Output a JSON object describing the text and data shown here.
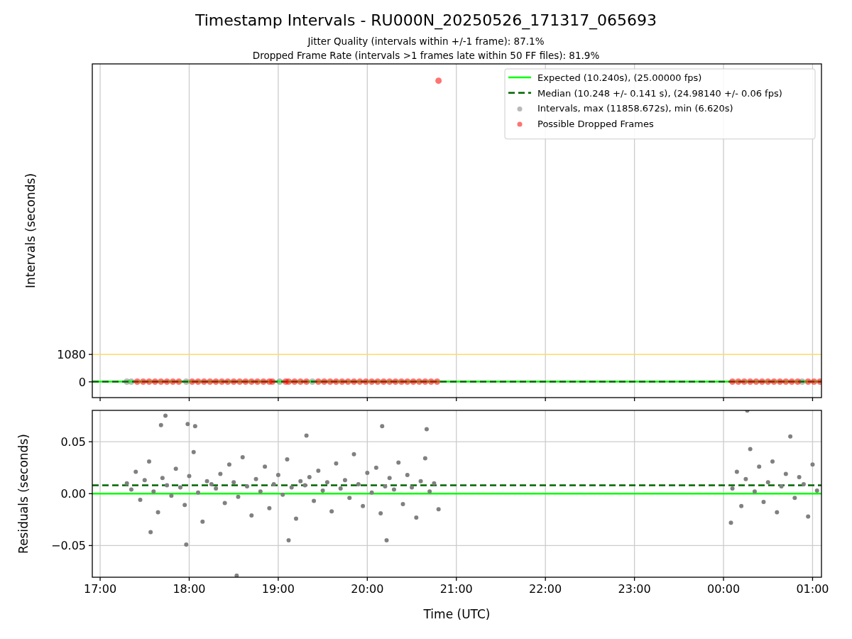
{
  "figure": {
    "title": "Timestamp Intervals - RU000N_20250526_171317_065693",
    "subtitles": [
      "Jitter Quality (intervals within +/-1 frame): 87.1%",
      "Dropped Frame Rate (intervals >1 frames late within 50 FF files): 81.9%"
    ]
  },
  "charts": [
    {
      "chart_data": {
        "type": "scatter",
        "ylabel": "Intervals (seconds)",
        "grid": "x",
        "legend": "upper right",
        "xlim": [
          "2025-05-26T16:54:43",
          "2025-05-27T01:06:00"
        ],
        "ylim": [
          -620,
          12520
        ],
        "yticks": [
          {
            "value": 0,
            "label": "0"
          },
          {
            "value": 1080,
            "label": "1080"
          }
        ],
        "ref_lines": [
          {
            "axis": "y",
            "value": 1080,
            "color": "#ffd966"
          },
          {
            "axis": "y",
            "value": 10.24,
            "color": "#00ff00",
            "label": "Expected (10.240s), (25.00000 fps)"
          },
          {
            "axis": "y",
            "value": 10.248,
            "color": "#006400",
            "label": "Median (10.248 +/- 0.141 s), (24.98140 +/- 0.06 fps)"
          }
        ],
        "series": [
          {
            "name": "Intervals, max (11858.672s), min (6.620s)",
            "color": "#808080",
            "x": [
              "2025-05-26T17:18",
              "2025-05-26T17:21",
              "2025-05-26T17:58",
              "2025-05-26T19:01",
              "2025-05-26T19:23",
              "2025-05-27T00:53"
            ],
            "values": [
              10,
              10,
              10,
              10,
              10,
              10
            ]
          },
          {
            "name": "Possible Dropped Frames",
            "color": "#ff0000",
            "x": [
              "2025-05-26T17:25",
              "2025-05-26T17:29",
              "2025-05-26T17:33",
              "2025-05-26T17:37",
              "2025-05-26T17:41",
              "2025-05-26T17:45",
              "2025-05-26T17:49",
              "2025-05-26T17:53",
              "2025-05-26T18:02",
              "2025-05-26T18:06",
              "2025-05-26T18:10",
              "2025-05-26T18:14",
              "2025-05-26T18:18",
              "2025-05-26T18:22",
              "2025-05-26T18:26",
              "2025-05-26T18:30",
              "2025-05-26T18:34",
              "2025-05-26T18:38",
              "2025-05-26T18:42",
              "2025-05-26T18:46",
              "2025-05-26T18:50",
              "2025-05-26T18:54",
              "2025-05-26T18:56",
              "2025-05-26T19:05",
              "2025-05-26T19:07",
              "2025-05-26T19:11",
              "2025-05-26T19:15",
              "2025-05-26T19:19",
              "2025-05-26T19:27",
              "2025-05-26T19:31",
              "2025-05-26T19:35",
              "2025-05-26T19:39",
              "2025-05-26T19:43",
              "2025-05-26T19:47",
              "2025-05-26T19:51",
              "2025-05-26T19:55",
              "2025-05-26T19:59",
              "2025-05-26T20:03",
              "2025-05-26T20:07",
              "2025-05-26T20:11",
              "2025-05-26T20:15",
              "2025-05-26T20:19",
              "2025-05-26T20:23",
              "2025-05-26T20:27",
              "2025-05-26T20:31",
              "2025-05-26T20:35",
              "2025-05-26T20:39",
              "2025-05-26T20:43",
              "2025-05-26T20:47",
              "2025-05-27T00:06",
              "2025-05-27T00:10",
              "2025-05-27T00:14",
              "2025-05-27T00:18",
              "2025-05-27T00:22",
              "2025-05-27T00:26",
              "2025-05-27T00:30",
              "2025-05-27T00:34",
              "2025-05-27T00:38",
              "2025-05-27T00:42",
              "2025-05-27T00:46",
              "2025-05-27T00:50",
              "2025-05-27T00:57",
              "2025-05-27T01:01",
              "2025-05-27T01:05",
              "2025-05-26T20:48"
            ],
            "values": [
              10,
              10,
              10,
              10,
              10,
              10,
              10,
              10,
              10,
              10,
              10,
              10,
              10,
              10,
              10,
              10,
              10,
              10,
              10,
              10,
              10,
              10,
              10,
              10,
              10,
              10,
              10,
              10,
              10,
              10,
              10,
              10,
              10,
              10,
              10,
              10,
              10,
              10,
              10,
              10,
              10,
              10,
              10,
              10,
              10,
              10,
              10,
              10,
              10,
              10,
              10,
              10,
              10,
              10,
              10,
              10,
              10,
              10,
              10,
              10,
              10,
              10,
              10,
              10,
              11858.672
            ]
          }
        ]
      }
    },
    {
      "chart_data": {
        "type": "scatter",
        "xlabel": "Time (UTC)",
        "ylabel": "Residuals (seconds)",
        "grid": "both",
        "xlim": [
          "2025-05-26T16:54:43",
          "2025-05-27T01:06:00"
        ],
        "ylim": [
          -0.0805,
          0.0802
        ],
        "xticks": [
          {
            "value": "2025-05-26T17:00",
            "label": "17:00"
          },
          {
            "value": "2025-05-26T18:00",
            "label": "18:00"
          },
          {
            "value": "2025-05-26T19:00",
            "label": "19:00"
          },
          {
            "value": "2025-05-26T20:00",
            "label": "20:00"
          },
          {
            "value": "2025-05-26T21:00",
            "label": "21:00"
          },
          {
            "value": "2025-05-26T22:00",
            "label": "22:00"
          },
          {
            "value": "2025-05-26T23:00",
            "label": "23:00"
          },
          {
            "value": "2025-05-27T00:00",
            "label": "00:00"
          },
          {
            "value": "2025-05-27T01:00",
            "label": "01:00"
          }
        ],
        "yticks": [
          {
            "value": -0.05,
            "label": "−0.05"
          },
          {
            "value": 0,
            "label": "0.00"
          },
          {
            "value": 0.05,
            "label": "0.05"
          }
        ],
        "ref_lines": [
          {
            "axis": "y",
            "value": 0,
            "color": "#00ff00"
          },
          {
            "axis": "y",
            "value": 0.008,
            "color": "#006400"
          }
        ],
        "series": [
          {
            "color": "#808080",
            "x": [
              "2025-05-26T17:18",
              "2025-05-26T17:21",
              "2025-05-26T17:24",
              "2025-05-26T17:27",
              "2025-05-26T17:30",
              "2025-05-26T17:33",
              "2025-05-26T17:36",
              "2025-05-26T17:39",
              "2025-05-26T17:42",
              "2025-05-26T17:45",
              "2025-05-26T17:48",
              "2025-05-26T17:51",
              "2025-05-26T17:54",
              "2025-05-26T17:57",
              "2025-05-26T18:00",
              "2025-05-26T18:03",
              "2025-05-26T18:06",
              "2025-05-26T18:09",
              "2025-05-26T18:12",
              "2025-05-26T18:15",
              "2025-05-26T18:18",
              "2025-05-26T18:21",
              "2025-05-26T18:24",
              "2025-05-26T18:27",
              "2025-05-26T18:30",
              "2025-05-26T18:33",
              "2025-05-26T18:36",
              "2025-05-26T18:39",
              "2025-05-26T18:42",
              "2025-05-26T18:45",
              "2025-05-26T18:48",
              "2025-05-26T18:51",
              "2025-05-26T18:54",
              "2025-05-26T18:57",
              "2025-05-26T19:00",
              "2025-05-26T19:03",
              "2025-05-26T19:06",
              "2025-05-26T19:09",
              "2025-05-26T19:12",
              "2025-05-26T19:15",
              "2025-05-26T19:18",
              "2025-05-26T19:21",
              "2025-05-26T19:24",
              "2025-05-26T19:27",
              "2025-05-26T19:30",
              "2025-05-26T19:33",
              "2025-05-26T19:36",
              "2025-05-26T19:39",
              "2025-05-26T19:42",
              "2025-05-26T19:45",
              "2025-05-26T19:48",
              "2025-05-26T19:51",
              "2025-05-26T19:54",
              "2025-05-26T19:57",
              "2025-05-26T20:00",
              "2025-05-26T20:03",
              "2025-05-26T20:06",
              "2025-05-26T20:09",
              "2025-05-26T20:12",
              "2025-05-26T20:15",
              "2025-05-26T20:18",
              "2025-05-26T20:21",
              "2025-05-26T20:24",
              "2025-05-26T20:27",
              "2025-05-26T20:30",
              "2025-05-26T20:33",
              "2025-05-26T20:36",
              "2025-05-26T20:39",
              "2025-05-26T20:42",
              "2025-05-26T20:45",
              "2025-05-26T20:48",
              "2025-05-26T17:44",
              "2025-05-26T17:41",
              "2025-05-26T17:59",
              "2025-05-26T18:04",
              "2025-05-26T17:58",
              "2025-05-26T18:32",
              "2025-05-26T19:07",
              "2025-05-26T20:13",
              "2025-05-26T20:10",
              "2025-05-26T20:40",
              "2025-05-26T17:34",
              "2025-05-26T19:19",
              "2025-05-27T00:06",
              "2025-05-27T00:09",
              "2025-05-27T00:12",
              "2025-05-27T00:15",
              "2025-05-27T00:18",
              "2025-05-27T00:21",
              "2025-05-27T00:24",
              "2025-05-27T00:27",
              "2025-05-27T00:30",
              "2025-05-27T00:33",
              "2025-05-27T00:36",
              "2025-05-27T00:39",
              "2025-05-27T00:42",
              "2025-05-27T00:45",
              "2025-05-27T00:48",
              "2025-05-27T00:51",
              "2025-05-27T00:54",
              "2025-05-27T00:57",
              "2025-05-27T01:00",
              "2025-05-27T01:03",
              "2025-05-27T00:16",
              "2025-05-27T00:05"
            ],
            "values": [
              0.01,
              0.004,
              0.021,
              -0.006,
              0.013,
              0.031,
              0.002,
              -0.018,
              0.015,
              0.008,
              -0.002,
              0.024,
              0.006,
              -0.011,
              0.017,
              0.04,
              0.001,
              -0.027,
              0.012,
              0.009,
              0.005,
              0.019,
              -0.009,
              0.028,
              0.011,
              -0.003,
              0.035,
              0.007,
              -0.021,
              0.014,
              0.002,
              0.026,
              -0.014,
              0.009,
              0.018,
              -0.001,
              0.033,
              0.006,
              -0.024,
              0.012,
              0.008,
              0.016,
              -0.007,
              0.022,
              0.003,
              0.011,
              -0.017,
              0.029,
              0.005,
              0.013,
              -0.004,
              0.038,
              0.009,
              -0.012,
              0.02,
              0.001,
              0.025,
              -0.019,
              0.007,
              0.015,
              0.004,
              0.03,
              -0.01,
              0.018,
              0.006,
              -0.023,
              0.012,
              0.034,
              0.002,
              0.01,
              -0.015,
              0.075,
              0.066,
              0.067,
              0.065,
              -0.049,
              -0.079,
              -0.045,
              -0.045,
              0.065,
              0.062,
              -0.037,
              0.056,
              0.005,
              0.021,
              -0.012,
              0.014,
              0.043,
              0.002,
              0.026,
              -0.008,
              0.011,
              0.031,
              -0.018,
              0.007,
              0.019,
              0.055,
              -0.004,
              0.016,
              0.009,
              -0.022,
              0.028,
              0.003,
              0.08,
              -0.028
            ]
          }
        ]
      }
    }
  ]
}
